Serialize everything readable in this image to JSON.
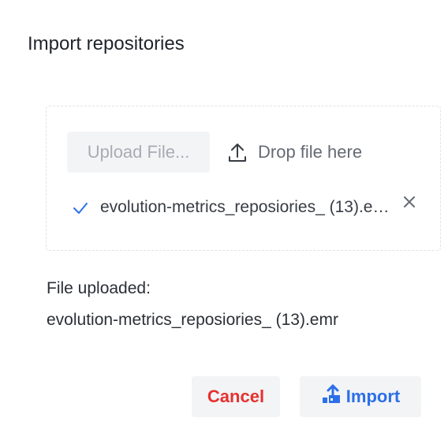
{
  "dialog": {
    "title": "Import repositories"
  },
  "dropzone": {
    "upload_button_label": "Upload File...",
    "drop_hint": "Drop file here",
    "file_name_truncated": "evolution-metrics_reposiories_ (13).emr",
    "upload_icon": "upload-icon",
    "check_icon": "check-icon",
    "remove_icon": "close-icon"
  },
  "status": {
    "label": "File uploaded:",
    "file_name": "evolution-metrics_reposiories_ (13).emr"
  },
  "actions": {
    "cancel_label": "Cancel",
    "import_label": "Import",
    "import_icon": "import-icon"
  },
  "colors": {
    "accent": "#2c6fe8",
    "danger": "#e5312f",
    "button_bg": "#f3f4f6",
    "disabled_text": "#a7acb4"
  }
}
